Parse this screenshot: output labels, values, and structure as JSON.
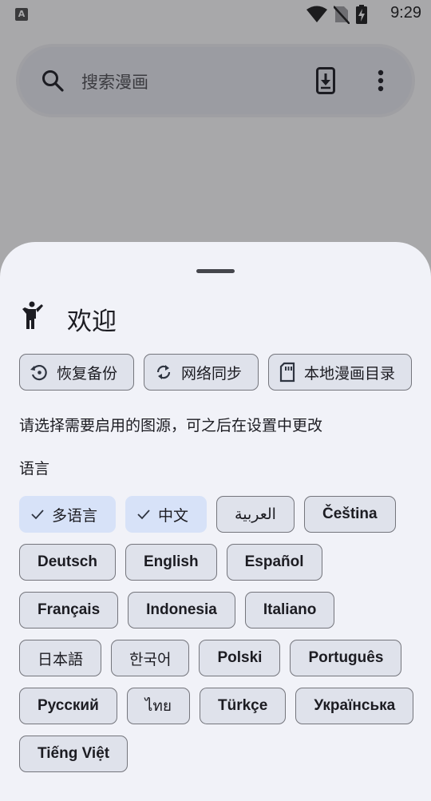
{
  "status_bar": {
    "app_icon_letter": "A",
    "time": "9:29",
    "icons": [
      "wifi-icon",
      "no-sim-icon",
      "battery-charging-icon"
    ]
  },
  "search": {
    "placeholder": "搜索漫画",
    "icons": [
      "search-icon",
      "import-icon",
      "more-vert-icon"
    ]
  },
  "sheet": {
    "title": "欢迎",
    "title_icon": "person-walking-icon",
    "actions": [
      {
        "label": "恢复备份",
        "icon": "restore-icon"
      },
      {
        "label": "网络同步",
        "icon": "sync-icon"
      },
      {
        "label": "本地漫画目录",
        "icon": "sd-card-icon"
      }
    ],
    "intro": "请选择需要启用的图源，可之后在设置中更改",
    "language_label": "语言",
    "languages": [
      {
        "label": "多语言",
        "selected": true
      },
      {
        "label": "中文",
        "selected": true
      },
      {
        "label": "العربية",
        "selected": false
      },
      {
        "label": "Čeština",
        "selected": false
      },
      {
        "label": "Deutsch",
        "selected": false
      },
      {
        "label": "English",
        "selected": false
      },
      {
        "label": "Español",
        "selected": false
      },
      {
        "label": "Français",
        "selected": false
      },
      {
        "label": "Indonesia",
        "selected": false
      },
      {
        "label": "Italiano",
        "selected": false
      },
      {
        "label": "日本語",
        "selected": false
      },
      {
        "label": "한국어",
        "selected": false
      },
      {
        "label": "Polski",
        "selected": false
      },
      {
        "label": "Português",
        "selected": false
      },
      {
        "label": "Русский",
        "selected": false
      },
      {
        "label": "ไทย",
        "selected": false
      },
      {
        "label": "Türkçe",
        "selected": false
      },
      {
        "label": "Українська",
        "selected": false
      },
      {
        "label": "Tiếng Việt",
        "selected": false
      }
    ]
  }
}
